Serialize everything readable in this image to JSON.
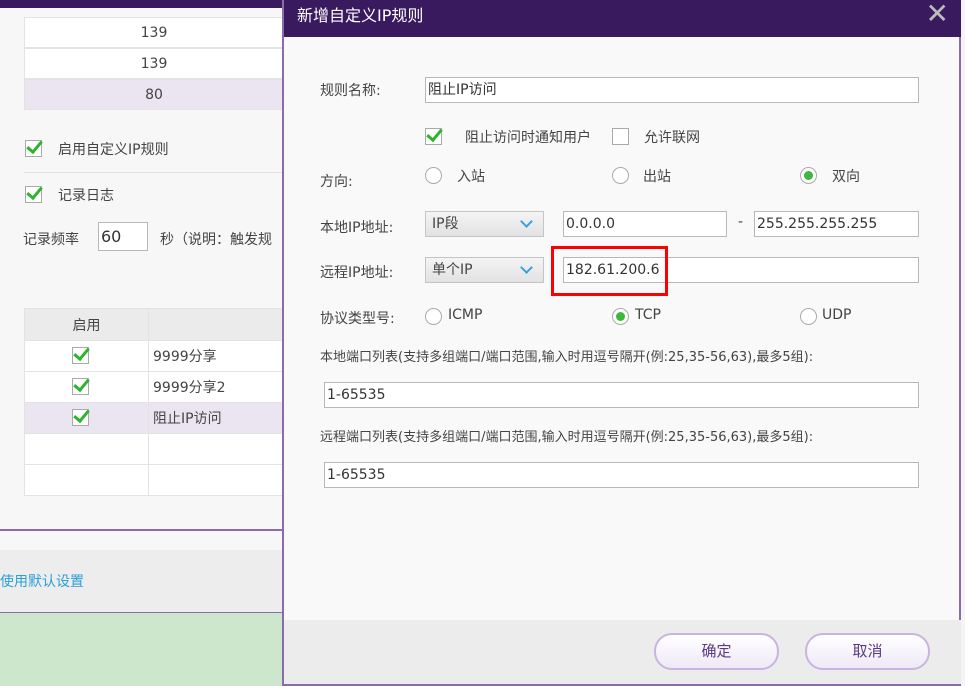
{
  "background_window": {
    "top_rows": [
      "139",
      "139",
      "80"
    ],
    "enable_custom_rules_label": "启用自定义IP规则",
    "log_label": "记录日志",
    "log_freq_label": "记录频率",
    "log_freq_value": "60",
    "log_freq_note": "秒（说明：触发规",
    "table_header": "启用",
    "rules": [
      {
        "name": "9999分享",
        "enabled": true
      },
      {
        "name": "9999分享2",
        "enabled": true
      },
      {
        "name": "阻止IP访问",
        "enabled": true
      }
    ],
    "default_link": "使用默认设置"
  },
  "dialog": {
    "title": "新增自定义IP规则",
    "rule_name_label": "规则名称:",
    "rule_name_value": "阻止IP访问",
    "notify_label": "阻止访问时通知用户",
    "allow_net_label": "允许联网",
    "direction_label": "方向:",
    "direction_options": [
      "入站",
      "出站",
      "双向"
    ],
    "direction_selected": "双向",
    "local_ip_label": "本地IP地址:",
    "local_ip_type": "IP段",
    "local_ip_start": "0.0.0.0",
    "local_ip_dash": "-",
    "local_ip_end": "255.255.255.255",
    "remote_ip_label": "远程IP地址:",
    "remote_ip_type": "单个IP",
    "remote_ip_value": "182.61.200.6",
    "protocol_label": "协议类型号:",
    "protocol_options": [
      "ICMP",
      "TCP",
      "UDP"
    ],
    "protocol_selected": "TCP",
    "local_ports_label": "本地端口列表(支持多组端口/端口范围,输入时用逗号隔开(例:25,35-56,63),最多5组):",
    "local_ports_value": "1-65535",
    "remote_ports_label": "远程端口列表(支持多组端口/端口范围,输入时用逗号隔开(例:25,35-56,63),最多5组):",
    "remote_ports_value": "1-65535",
    "ok_label": "确定",
    "cancel_label": "取消"
  },
  "colors": {
    "titlebar": "#3a1a5e",
    "highlight": "#ff0000",
    "link": "#2a9fd8"
  }
}
